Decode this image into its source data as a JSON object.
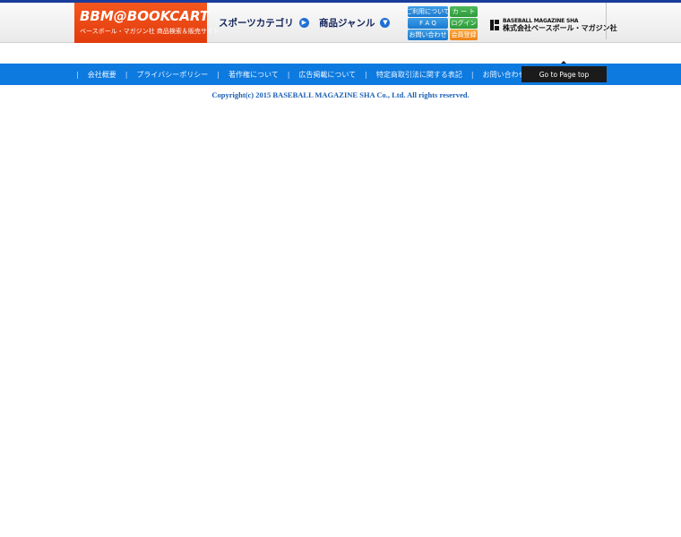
{
  "header": {
    "logo_main": "BBM@BOOKCART",
    "logo_sub": "ベースボール・マガジン社 商品検索＆販売サイト",
    "nav": {
      "sports_category": "スポーツカテゴリ",
      "product_genre": "商品ジャンル"
    },
    "mini_buttons": {
      "about_usage": "ご利用について",
      "cart": "カ ー ト",
      "faq": "F A Q",
      "login": "ログイン",
      "contact": "お問い合わせ",
      "member_register": "会員登録"
    },
    "publisher_en": "BASEBALL MAGAZINE SHA",
    "publisher_ja": "株式会社ベースボール・マガジン社"
  },
  "footer": {
    "links": [
      "会社概要",
      "プライバシーポリシー",
      "著作権について",
      "広告掲載について",
      "特定商取引法に関する表記",
      "お問い合わせ"
    ],
    "separator": "|",
    "page_top": "Go to Page top",
    "copyright": "Copyright(c) 2015 BASEBALL MAGAZINE SHA Co., Ltd. All rights reserved."
  },
  "colors": {
    "logo_orange": "#e8461a",
    "footer_blue": "#0d7ae0",
    "top_strip": "#1a3d9c",
    "copyright_text": "#1a5fb4"
  }
}
